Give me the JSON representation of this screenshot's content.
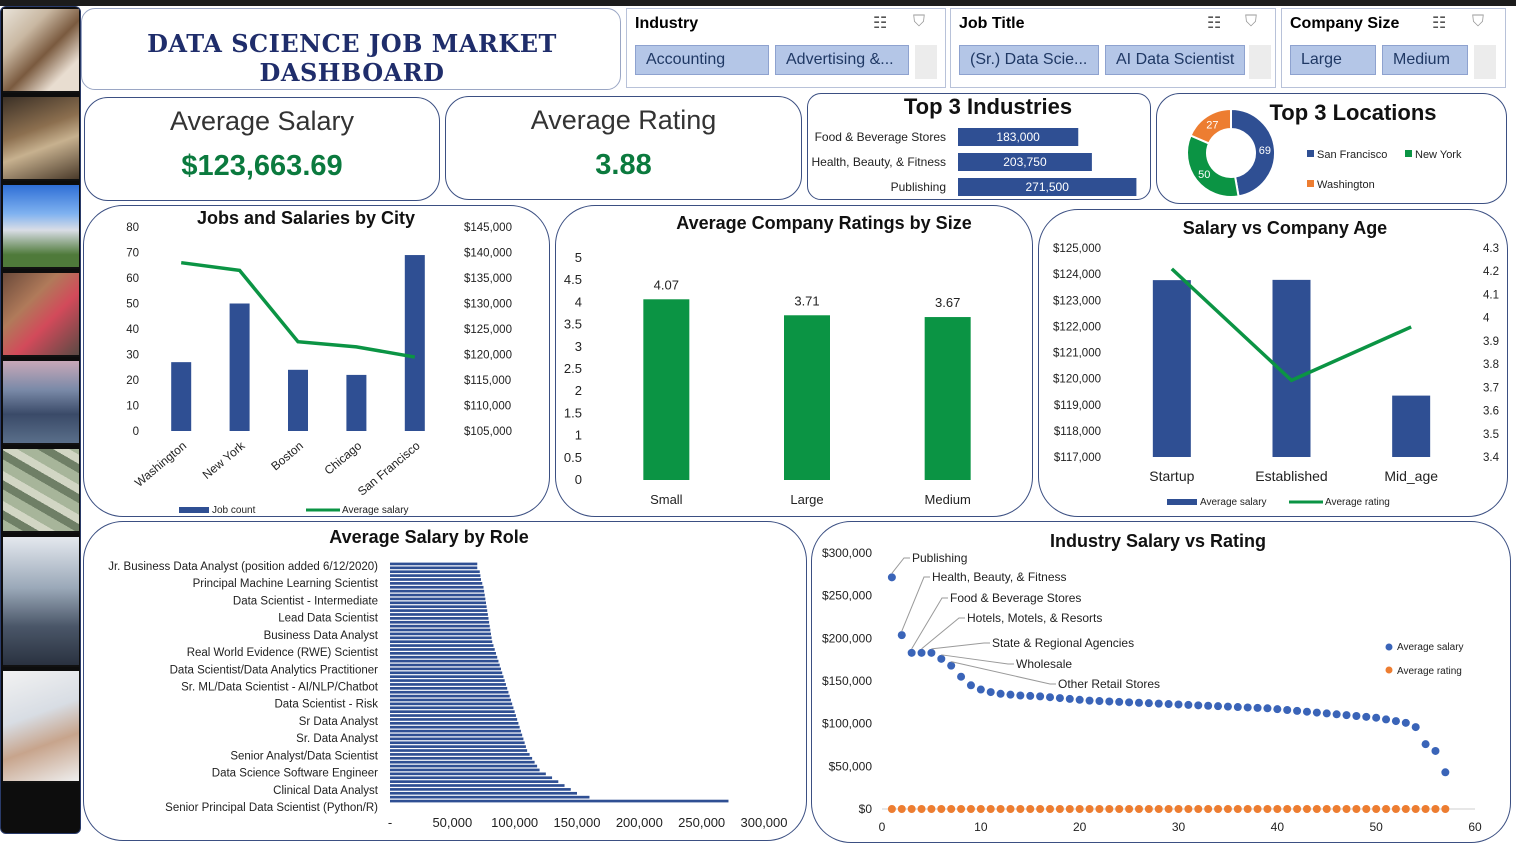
{
  "dashboard": {
    "title": "DATA SCIENCE JOB MARKET DASHBOARD"
  },
  "colors": {
    "navy": "#2f4f93",
    "green": "#0b9444",
    "orange": "#ed7d31",
    "title": "#1f2d6b",
    "kpi": "#0b7a3e"
  },
  "sidebar": {
    "images": [
      "office-meeting-photo",
      "city-street-photo",
      "office-building-photo",
      "factory-workers-photo",
      "city-skyline-photo",
      "money-bills-photo",
      "conference-room-photo",
      "laptop-analytics-photo"
    ]
  },
  "slicers": {
    "industry": {
      "label": "Industry",
      "items": [
        "Accounting",
        "Advertising &..."
      ],
      "icons": [
        "multi-select-icon",
        "clear-filter-icon"
      ]
    },
    "job_title": {
      "label": "Job Title",
      "items": [
        "(Sr.) Data Scie...",
        "AI Data Scientist"
      ],
      "icons": [
        "multi-select-icon",
        "clear-filter-icon"
      ]
    },
    "company_size": {
      "label": "Company Size",
      "items": [
        "Large",
        "Medium"
      ],
      "icons": [
        "multi-select-icon",
        "clear-filter-icon"
      ]
    }
  },
  "kpis": {
    "avg_salary": {
      "label": "Average Salary",
      "value": "$123,663.69"
    },
    "avg_rating": {
      "label": "Average Rating",
      "value": "3.88"
    }
  },
  "top_industries": {
    "title": "Top 3 Industries",
    "items": [
      {
        "label": "Food & Beverage Stores",
        "value": 183000,
        "value_label": "183,000"
      },
      {
        "label": "Health, Beauty, & Fitness",
        "value": 203750,
        "value_label": "203,750"
      },
      {
        "label": "Publishing",
        "value": 271500,
        "value_label": "271,500"
      }
    ]
  },
  "top_locations": {
    "title": "Top 3 Locations",
    "slices": [
      {
        "label": "San Francisco",
        "value": 69,
        "color": "#2f4f93"
      },
      {
        "label": "New York",
        "value": 50,
        "color": "#0b9444"
      },
      {
        "label": "Washington",
        "value": 27,
        "color": "#ed7d31"
      }
    ]
  },
  "chart_data": [
    {
      "id": "city",
      "type": "bar",
      "title": "Jobs and Salaries by City",
      "categories": [
        "Washington",
        "New York",
        "Boston",
        "Chicago",
        "San Francisco"
      ],
      "series": [
        {
          "name": "Job count",
          "kind": "bar",
          "axis": "left",
          "values": [
            27,
            50,
            24,
            22,
            69
          ]
        },
        {
          "name": "Average salary",
          "kind": "line",
          "axis": "right",
          "values": [
            138000,
            136500,
            122500,
            121500,
            119500
          ]
        }
      ],
      "y_left": {
        "min": 0,
        "max": 80,
        "ticks": [
          "0",
          "10",
          "20",
          "30",
          "40",
          "50",
          "60",
          "70",
          "80"
        ]
      },
      "y_right": {
        "min": 105000,
        "max": 145000,
        "ticks": [
          "$105,000",
          "$110,000",
          "$115,000",
          "$120,000",
          "$125,000",
          "$130,000",
          "$135,000",
          "$140,000",
          "$145,000"
        ]
      },
      "legend": "bottom"
    },
    {
      "id": "size",
      "type": "bar",
      "title": "Average Company Ratings by Size",
      "categories": [
        "Small",
        "Large",
        "Medium"
      ],
      "values": [
        4.07,
        3.71,
        3.67
      ],
      "value_labels": [
        "4.07",
        "3.71",
        "3.67"
      ],
      "ylim": [
        0,
        5
      ],
      "y_ticks": [
        "0",
        "0.5",
        "1",
        "1.5",
        "2",
        "2.5",
        "3",
        "3.5",
        "4",
        "4.5",
        "5"
      ]
    },
    {
      "id": "age",
      "type": "bar",
      "title": "Salary vs Company Age",
      "categories": [
        "Startup",
        "Established",
        "Mid_age"
      ],
      "series": [
        {
          "name": "Average salary",
          "kind": "bar",
          "axis": "left",
          "values": [
            123770,
            123780,
            119350
          ]
        },
        {
          "name": "Average rating",
          "kind": "line",
          "axis": "right",
          "values": [
            4.21,
            3.73,
            3.96
          ]
        }
      ],
      "y_left": {
        "min": 117000,
        "max": 125000,
        "ticks": [
          "$117,000",
          "$118,000",
          "$119,000",
          "$120,000",
          "$121,000",
          "$122,000",
          "$123,000",
          "$124,000",
          "$125,000"
        ]
      },
      "y_right": {
        "min": 3.4,
        "max": 4.3,
        "ticks": [
          "3.4",
          "3.5",
          "3.6",
          "3.7",
          "3.8",
          "3.9",
          "4",
          "4.1",
          "4.2",
          "4.3"
        ]
      },
      "legend": "bottom"
    },
    {
      "id": "role",
      "type": "bar",
      "orientation": "horizontal",
      "title": "Average Salary by Role",
      "labels": [
        "Jr. Business Data Analyst (position added 6/12/2020)",
        "Principal Machine Learning Scientist",
        "Data Scientist - Intermediate",
        "Lead Data Scientist",
        "Business Data Analyst",
        "Real World Evidence (RWE) Scientist",
        "Data Scientist/Data Analytics Practitioner",
        "Sr. ML/Data Scientist - AI/NLP/Chatbot",
        "Data Scientist - Risk",
        "Sr Data Analyst",
        "Sr. Data Analyst",
        "Senior Analyst/Data Scientist",
        "Data Science Software Engineer",
        "Clinical Data Analyst",
        "Senior Principal Data Scientist (Python/R)"
      ],
      "values": [
        70000,
        70000,
        72000,
        72500,
        73000,
        74000,
        75000,
        75500,
        76000,
        76500,
        77000,
        77500,
        78000,
        78500,
        79000,
        79500,
        80000,
        80500,
        81000,
        81500,
        82000,
        83000,
        84000,
        85000,
        86000,
        87000,
        88000,
        89000,
        90000,
        91000,
        92000,
        93000,
        94000,
        95000,
        96000,
        97000,
        98000,
        99000,
        100000,
        101000,
        102000,
        103000,
        104000,
        105000,
        106000,
        107000,
        108000,
        109000,
        110000,
        112000,
        114000,
        116000,
        118000,
        120000,
        125000,
        130000,
        135000,
        140000,
        145000,
        150000,
        160000,
        271500
      ],
      "x_ticks": [
        "-",
        "50,000",
        "100,000",
        "150,000",
        "200,000",
        "250,000",
        "300,000"
      ],
      "xlim": [
        0,
        300000
      ]
    },
    {
      "id": "industry",
      "type": "scatter",
      "title": "Industry Salary vs Rating",
      "x": [
        1,
        2,
        3,
        4,
        5,
        6,
        7,
        8,
        9,
        10,
        11,
        12,
        13,
        14,
        15,
        16,
        17,
        18,
        19,
        20,
        21,
        22,
        23,
        24,
        25,
        26,
        27,
        28,
        29,
        30,
        31,
        32,
        33,
        34,
        35,
        36,
        37,
        38,
        39,
        40,
        41,
        42,
        43,
        44,
        45,
        46,
        47,
        48,
        49,
        50,
        51,
        52,
        53,
        54,
        55,
        56,
        57
      ],
      "series": [
        {
          "name": "Average salary",
          "values": [
            271500,
            203750,
            183000,
            183000,
            183000,
            176000,
            168000,
            155000,
            145000,
            140000,
            137000,
            135000,
            134000,
            133000,
            132500,
            132000,
            131000,
            130000,
            129000,
            128000,
            127000,
            126500,
            126000,
            125500,
            125000,
            124500,
            124000,
            123500,
            123000,
            122500,
            122000,
            121500,
            121000,
            120500,
            120000,
            119500,
            119000,
            118500,
            118000,
            117000,
            116000,
            115000,
            114000,
            113000,
            112000,
            111000,
            110000,
            109000,
            108000,
            107000,
            105000,
            103000,
            101000,
            96000,
            76000,
            68000,
            43000
          ]
        },
        {
          "name": "Average rating",
          "values": [
            3.9,
            3.7,
            3.8,
            4.0,
            3.6,
            3.9,
            3.8,
            3.7,
            4.1,
            3.9,
            3.8,
            3.9,
            3.7,
            4.0,
            3.8,
            3.9,
            3.6,
            3.8,
            3.9,
            4.0,
            3.7,
            3.8,
            3.9,
            3.8,
            3.7,
            4.0,
            3.9,
            3.8,
            3.7,
            3.9,
            3.8,
            3.9,
            4.0,
            3.7,
            3.8,
            3.9,
            3.8,
            3.7,
            3.9,
            3.8,
            4.0,
            3.9,
            3.8,
            3.7,
            3.9,
            3.8,
            3.9,
            3.7,
            3.8,
            3.9,
            4.0,
            3.8,
            3.7,
            3.9,
            3.8,
            3.6,
            3.9
          ]
        }
      ],
      "annotations": [
        {
          "label": "Publishing",
          "x": 1
        },
        {
          "label": "Health, Beauty, & Fitness",
          "x": 2
        },
        {
          "label": "Food & Beverage Stores",
          "x": 3
        },
        {
          "label": "Hotels, Motels, & Resorts",
          "x": 4
        },
        {
          "label": "State & Regional Agencies",
          "x": 5
        },
        {
          "label": "Wholesale",
          "x": 6
        },
        {
          "label": "Other Retail Stores",
          "x": 7
        }
      ],
      "xlim": [
        0,
        60
      ],
      "x_ticks": [
        "0",
        "10",
        "20",
        "30",
        "40",
        "50",
        "60"
      ],
      "ylim": [
        0,
        300000
      ],
      "y_ticks": [
        "$0",
        "$50,000",
        "$100,000",
        "$150,000",
        "$200,000",
        "$250,000",
        "$300,000"
      ],
      "legend": "right"
    }
  ]
}
